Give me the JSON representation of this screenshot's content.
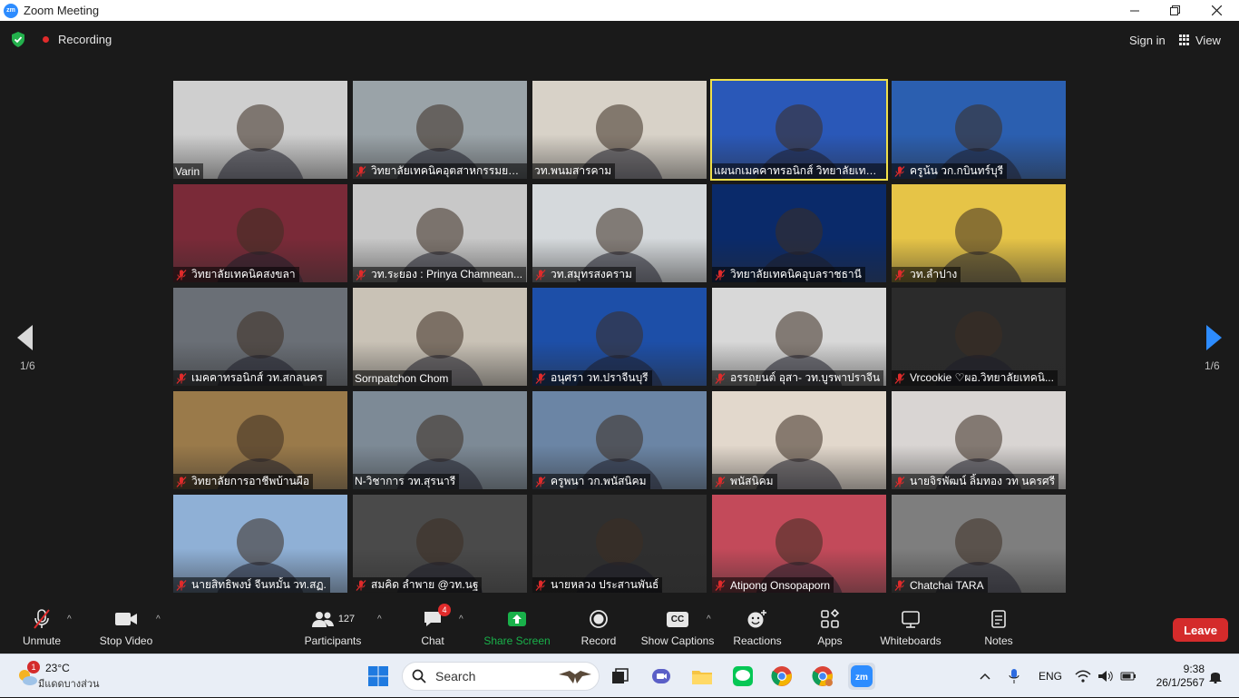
{
  "window": {
    "title": "Zoom Meeting",
    "logo_text": "zm"
  },
  "topbar": {
    "recording_label": "Recording",
    "signin_label": "Sign in",
    "view_label": "View"
  },
  "pager": {
    "left_label": "1/6",
    "right_label": "1/6"
  },
  "tiles": [
    {
      "name": "Varin",
      "muted": false,
      "bg": "#cfcfcf"
    },
    {
      "name": "วิทยาลัยเทคนิคอุตสาหกรรมยาน...",
      "muted": true,
      "bg": "#9aa3a8"
    },
    {
      "name": "วท.พนมสารคาม",
      "muted": false,
      "bg": "#d8d2c8"
    },
    {
      "name": "แผนกเมคคาทรอนิกส์ วิทยาลัยเทคนิ...",
      "muted": false,
      "bg": "#2a58b8"
    },
    {
      "name": "ครูน้น วก.กบินทร์บุรี",
      "muted": true,
      "bg": "#2b5fb0"
    },
    {
      "name": "วิทยาลัยเทคนิคสงขลา",
      "muted": true,
      "bg": "#7a2a38"
    },
    {
      "name": "วท.ระยอง : Prinya Chamnean...",
      "muted": true,
      "bg": "#c8c8c8"
    },
    {
      "name": "วท.สมุทรสงคราม",
      "muted": true,
      "bg": "#d5d9dc"
    },
    {
      "name": "วิทยาลัยเทคนิคอุบลราชธานี",
      "muted": true,
      "bg": "#0a2a6a"
    },
    {
      "name": "วท.ลำปาง",
      "muted": true,
      "bg": "#e6c447"
    },
    {
      "name": "เมคคาทรอนิกส์ วท.สกลนคร",
      "muted": true,
      "bg": "#6a6f76"
    },
    {
      "name": "Sornpatchon Chom",
      "muted": false,
      "bg": "#c9c2b6"
    },
    {
      "name": "อนุศรา วท.ปราจีนบุรี",
      "muted": true,
      "bg": "#1d4fa8"
    },
    {
      "name": "อรรถยนต์ อุสา- วท.บูรพาปราจีน",
      "muted": true,
      "bg": "#d8d8d8"
    },
    {
      "name": "Vrcookie ♡ผอ.วิทยาลัยเทคนิ...",
      "muted": true,
      "bg": "#2b2b2b"
    },
    {
      "name": "วิทยาลัยการอาชีพบ้านผือ",
      "muted": true,
      "bg": "#9a7a4a"
    },
    {
      "name": "N-วิชาการ วท.สุรนารี",
      "muted": false,
      "bg": "#7d8a96"
    },
    {
      "name": "ครูพนา วก.พนัสนิคม",
      "muted": true,
      "bg": "#6b85a5"
    },
    {
      "name": "พนัสนิคม",
      "muted": true,
      "bg": "#e2d8cc"
    },
    {
      "name": "นายจิรพัฒน์ ลิ้มทอง  วท นครศรี",
      "muted": true,
      "bg": "#d9d5d3"
    },
    {
      "name": "นายสิทธิพงษ์ จีนหมั้น วท.สฏ.",
      "muted": true,
      "bg": "#8fb0d6"
    },
    {
      "name": "สมคิด ลำพาย @วท.นฐ",
      "muted": true,
      "bg": "#4a4a4a"
    },
    {
      "name": "นายหลวง  ประสานพันธ์",
      "muted": true,
      "bg": "#2f2f2f"
    },
    {
      "name": "Atipong Onsopaporn",
      "muted": true,
      "bg": "#c34a5a"
    },
    {
      "name": "Chatchai TARA",
      "muted": true,
      "bg": "#7e7e7e"
    }
  ],
  "toolbar": {
    "unmute": "Unmute",
    "stop_video": "Stop Video",
    "participants": "Participants",
    "participants_count": "127",
    "chat": "Chat",
    "chat_badge": "4",
    "share": "Share Screen",
    "record": "Record",
    "captions": "Show Captions",
    "captions_icon_text": "CC",
    "reactions": "Reactions",
    "apps": "Apps",
    "whiteboards": "Whiteboards",
    "notes": "Notes",
    "leave": "Leave"
  },
  "taskbar": {
    "weather_badge": "1",
    "temperature": "23°C",
    "weather_text": "มีแดดบางส่วน",
    "search_placeholder": "Search",
    "language": "ENG",
    "time": "9:38",
    "date": "26/1/2567"
  },
  "colors": {
    "accent": "#2d8cff",
    "share_green": "#19b14a",
    "leave_red": "#d42b2b",
    "active_speaker": "#f0e04a"
  }
}
